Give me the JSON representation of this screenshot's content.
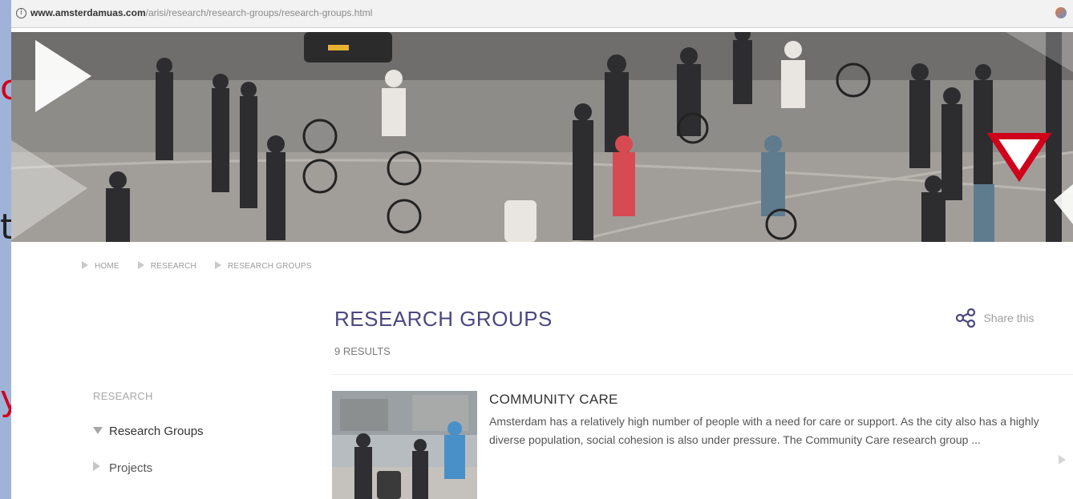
{
  "background_slide": {
    "letters": [
      "c",
      "t",
      "y"
    ],
    "color_first": "#d0021b",
    "color_second": "#222222",
    "color_third": "#d0021b"
  },
  "browser": {
    "url_host": "www.amsterdamuas.com",
    "url_path": "/arisi/research/research-groups/research-groups.html",
    "info_icon": "info-icon",
    "extension_icon": "extension-icon"
  },
  "breadcrumb": {
    "items": [
      "HOME",
      "RESEARCH",
      "RESEARCH GROUPS"
    ]
  },
  "main": {
    "title": "RESEARCH GROUPS",
    "results": "9 RESULTS",
    "share_label": "Share this",
    "accent_color": "#4b4781"
  },
  "sidebar": {
    "heading": "RESEARCH",
    "items": [
      {
        "label": "Research Groups",
        "selected": true
      },
      {
        "label": "Projects",
        "selected": false
      }
    ]
  },
  "results": [
    {
      "title": "COMMUNITY CARE",
      "description": "Amsterdam has a relatively high number of people with a need for care or support. As the city also has a highly diverse population, social cohesion is also under pressure. The Community Care research group ..."
    }
  ]
}
